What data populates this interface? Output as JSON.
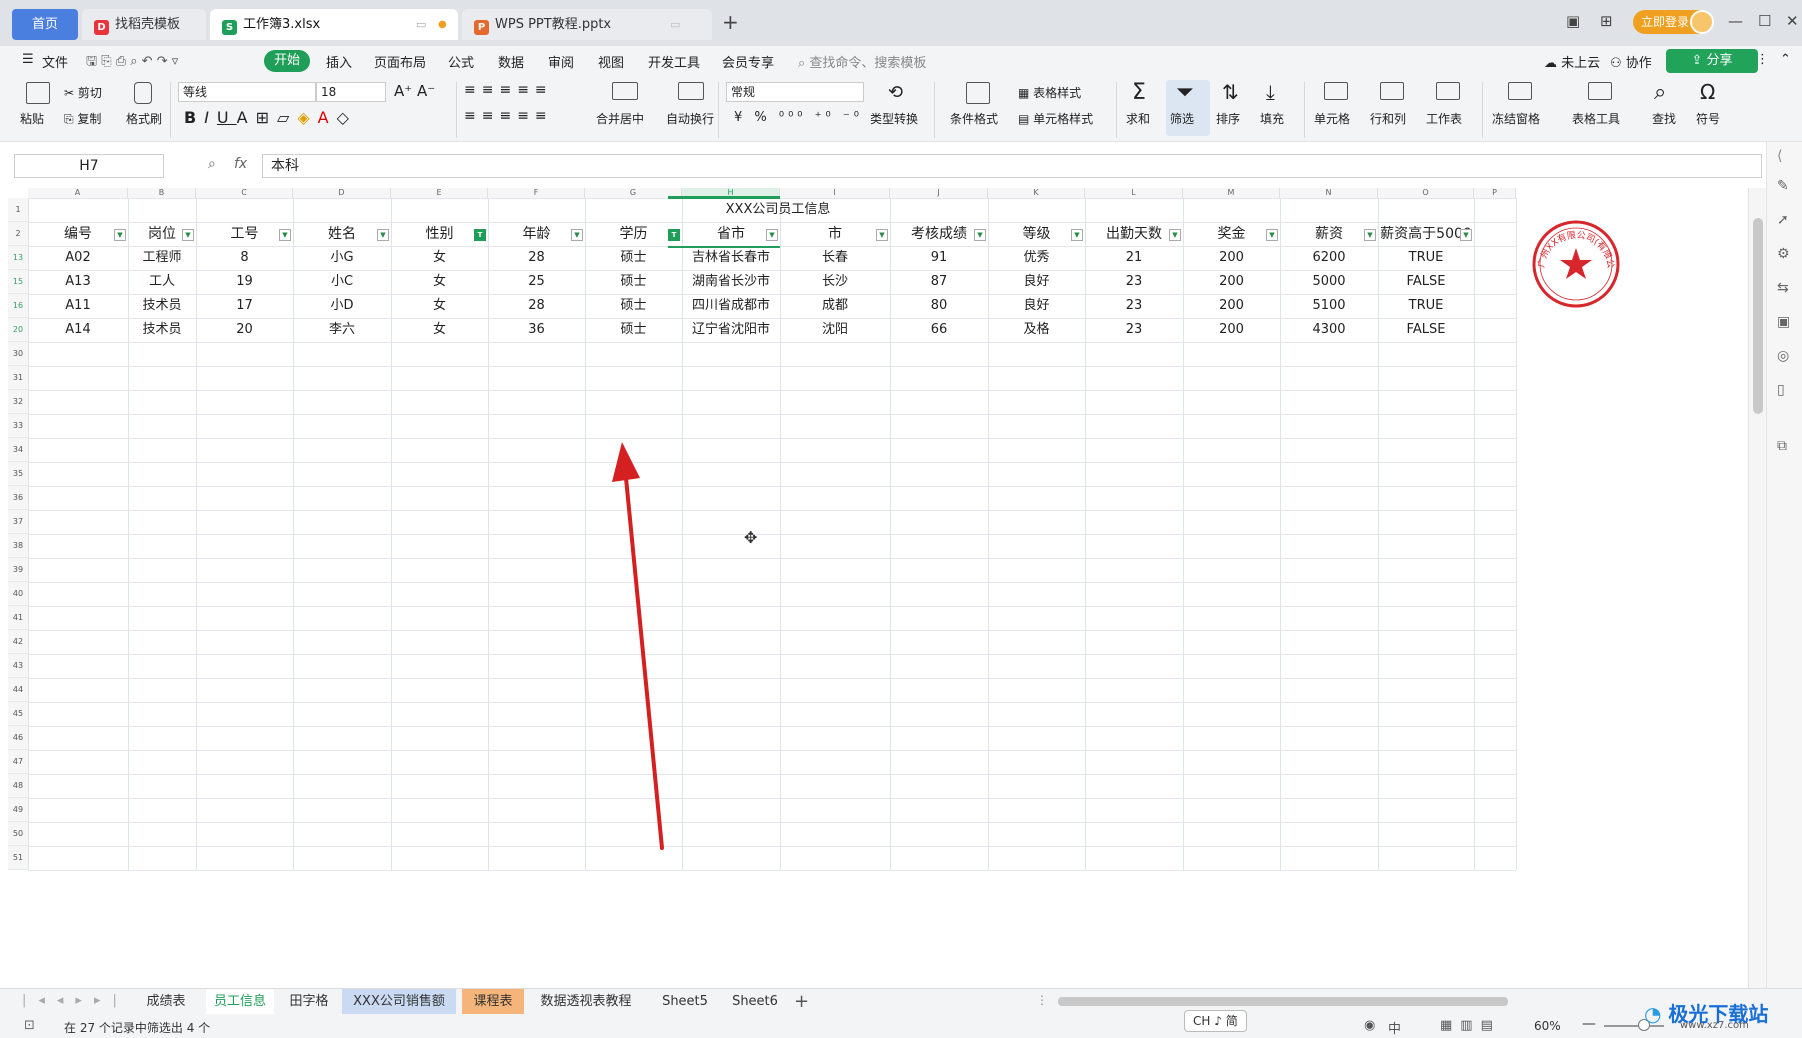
{
  "titlebar": {
    "tabs": [
      {
        "label": "首页"
      },
      {
        "label": "找稻壳模板"
      },
      {
        "label": "工作簿3.xlsx"
      },
      {
        "label": "WPS PPT教程.pptx"
      }
    ],
    "new_tab": "+",
    "login": "立即登录"
  },
  "menubar": {
    "file": "文件",
    "items": [
      "开始",
      "插入",
      "页面布局",
      "公式",
      "数据",
      "审阅",
      "视图",
      "开发工具",
      "会员专享"
    ],
    "search_placeholder": "查找命令、搜索模板",
    "cloud": "未上云",
    "collab": "协作",
    "share": "分享"
  },
  "ribbon": {
    "paste": "粘贴",
    "cut": "剪切",
    "copy": "复制",
    "format_painter": "格式刷",
    "font_name": "等线",
    "font_size": "18",
    "merge": "合并居中",
    "wrap": "自动换行",
    "number_format": "常规",
    "convert": "类型转换",
    "cond_format": "条件格式",
    "table_style": "表格样式",
    "cell_style": "单元格样式",
    "sum": "求和",
    "filter": "筛选",
    "sort": "排序",
    "fill": "填充",
    "cell": "单元格",
    "rowcol": "行和列",
    "sheet": "工作表",
    "freeze": "冻结窗格",
    "table_tools": "表格工具",
    "find": "查找",
    "symbol": "符号"
  },
  "formula_bar": {
    "name_box": "H7",
    "fx": "fx",
    "content": "本科"
  },
  "sheet": {
    "columns": [
      "A",
      "B",
      "C",
      "D",
      "E",
      "F",
      "G",
      "H",
      "I",
      "J",
      "K",
      "L",
      "M",
      "N",
      "O",
      "P"
    ],
    "title": "XXX公司员工信息",
    "headers": [
      "编号",
      "岗位",
      "工号",
      "姓名",
      "性别",
      "年龄",
      "学历",
      "省市",
      "市",
      "考核成绩",
      "等级",
      "出勤天数",
      "奖金",
      "薪资",
      "薪资高于5000"
    ],
    "rows": [
      {
        "num": "13",
        "cells": [
          "A02",
          "工程师",
          "8",
          "小G",
          "女",
          "28",
          "硕士",
          "吉林省长春市",
          "长春",
          "91",
          "优秀",
          "21",
          "200",
          "6200",
          "TRUE"
        ]
      },
      {
        "num": "15",
        "cells": [
          "A13",
          "工人",
          "19",
          "小C",
          "女",
          "25",
          "硕士",
          "湖南省长沙市",
          "长沙",
          "87",
          "良好",
          "23",
          "200",
          "5000",
          "FALSE"
        ]
      },
      {
        "num": "16",
        "cells": [
          "A11",
          "技术员",
          "17",
          "小D",
          "女",
          "28",
          "硕士",
          "四川省成都市",
          "成都",
          "80",
          "良好",
          "23",
          "200",
          "5100",
          "TRUE"
        ]
      },
      {
        "num": "20",
        "cells": [
          "A14",
          "技术员",
          "20",
          "李六",
          "女",
          "36",
          "硕士",
          "辽宁省沈阳市",
          "沈阳",
          "66",
          "及格",
          "23",
          "200",
          "4300",
          "FALSE"
        ]
      }
    ],
    "empty_rows": [
      "30",
      "31",
      "32",
      "33",
      "34",
      "35",
      "36",
      "37",
      "38",
      "39",
      "40",
      "41",
      "42",
      "43",
      "44",
      "45",
      "46",
      "47",
      "48",
      "49",
      "50",
      "51"
    ],
    "stamp_text": "广州XX有限公司(有限公司)"
  },
  "sheet_tabs": [
    "成绩表",
    "员工信息",
    "田字格",
    "XXX公司销售额",
    "课程表",
    "数据透视表教程",
    "Sheet5",
    "Sheet6"
  ],
  "status": {
    "filter_info": "在 27 个记录中筛选出 4 个",
    "ime": "CH ♪ 简",
    "zoom": "60%",
    "watermark": "极光下载站",
    "watermark_url": "www.xz7.com"
  },
  "colors": {
    "accent_green": "#1e9e58",
    "home_tab": "#4a7fe0",
    "login": "#f0a020",
    "stamp": "#d7262c",
    "arrow": "#d42020"
  }
}
